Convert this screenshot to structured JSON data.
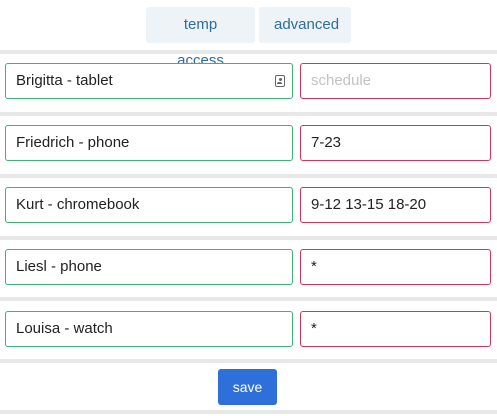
{
  "tabs": [
    {
      "label": "temp access"
    },
    {
      "label": "advanced"
    }
  ],
  "devices": [
    {
      "name": "Brigitta - tablet",
      "schedule": "",
      "schedule_placeholder": "schedule"
    },
    {
      "name": "Friedrich - phone",
      "schedule": "7-23"
    },
    {
      "name": "Kurt - chromebook",
      "schedule": "9-12 13-15 18-20"
    },
    {
      "name": "Liesl - phone",
      "schedule": "*"
    },
    {
      "name": "Louisa - watch",
      "schedule": "*"
    }
  ],
  "actions": {
    "save_label": "save"
  },
  "colors": {
    "tab_bg": "#eef3f8",
    "tab_text": "#2f6ca0",
    "name_border": "#3cb371",
    "schedule_border": "#d6335a",
    "save_bg": "#2f6fd9",
    "separator": "#e8e8e8"
  }
}
